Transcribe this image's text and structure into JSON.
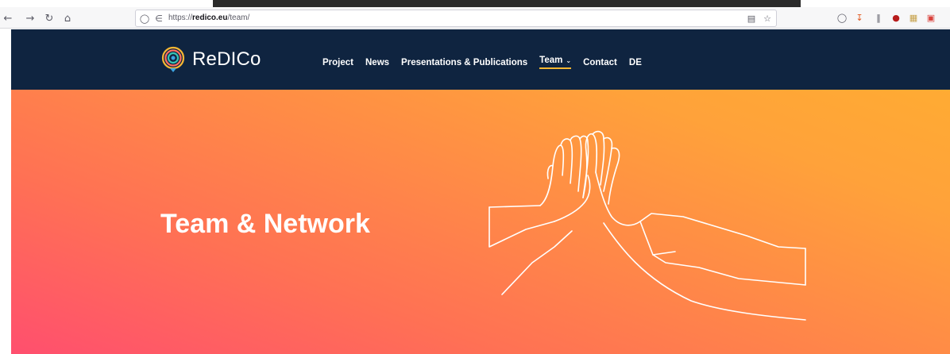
{
  "browser": {
    "nav_icons": [
      "back-icon",
      "forward-icon",
      "reload-icon",
      "home-icon"
    ],
    "url_prefix": "https://",
    "url_domain": "redico.eu",
    "url_path": "/team/",
    "toolbar_icons": [
      "reader-view-icon",
      "bookmark-star-icon",
      "pocket-icon",
      "download-icon",
      "library-icon",
      "ublock-icon",
      "notes-icon",
      "extension-icon"
    ]
  },
  "site": {
    "logo_text": "ReDICo",
    "nav": [
      {
        "label": "Project"
      },
      {
        "label": "News"
      },
      {
        "label": "Presentations & Publications"
      },
      {
        "label": "Team",
        "active": true
      },
      {
        "label": "Contact"
      },
      {
        "label": "DE"
      }
    ],
    "accent_color": "#f7b733",
    "header_color": "#0f2440"
  },
  "hero": {
    "title": "Team & Network",
    "illustration": "high-five-hands-illustration"
  }
}
